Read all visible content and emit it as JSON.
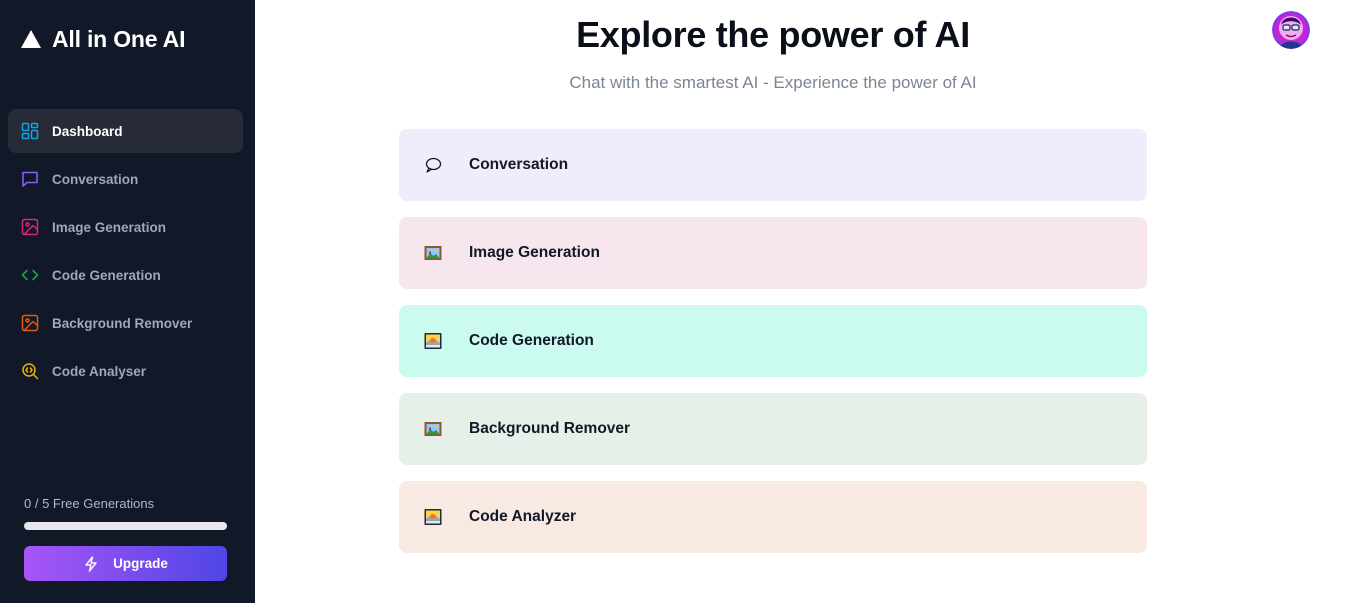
{
  "brand": {
    "title": "All in One AI",
    "logo_icon": "triangle-logo-icon"
  },
  "sidebar": {
    "items": [
      {
        "label": "Dashboard",
        "icon": "dashboard-icon",
        "color": "#0ea5e9",
        "active": true
      },
      {
        "label": "Conversation",
        "icon": "chat-bubble-icon",
        "color": "#8b5cf6",
        "active": false
      },
      {
        "label": "Image Generation",
        "icon": "image-icon",
        "color": "#db2777",
        "active": false
      },
      {
        "label": "Code Generation",
        "icon": "code-icon",
        "color": "#16a34a",
        "active": false
      },
      {
        "label": "Background Remover",
        "icon": "image-edit-icon",
        "color": "#ea580c",
        "active": false
      },
      {
        "label": "Code Analyser",
        "icon": "code-search-icon",
        "color": "#eab308",
        "active": false
      }
    ],
    "usage": {
      "text": "0 / 5 Free Generations",
      "used": 0,
      "limit": 5
    },
    "upgrade": {
      "label": "Upgrade",
      "icon": "lightning-icon"
    }
  },
  "header": {
    "title": "Explore the power of AI",
    "subtitle": "Chat with the smartest AI - Experience the power of AI",
    "avatar_icon": "user-avatar-icon"
  },
  "cards": [
    {
      "label": "Conversation",
      "icon": "speech-bubble-icon",
      "bg": "#f0ecfc"
    },
    {
      "label": "Image Generation",
      "icon": "framed-picture-icon",
      "bg": "#f7e6ee"
    },
    {
      "label": "Code Generation",
      "icon": "sunrise-picture-icon",
      "bg": "#cbfaee"
    },
    {
      "label": "Background Remover",
      "icon": "framed-picture-icon",
      "bg": "#e6f0e9"
    },
    {
      "label": "Code Analyzer",
      "icon": "sunrise-picture-icon",
      "bg": "#f8e9e3"
    }
  ]
}
